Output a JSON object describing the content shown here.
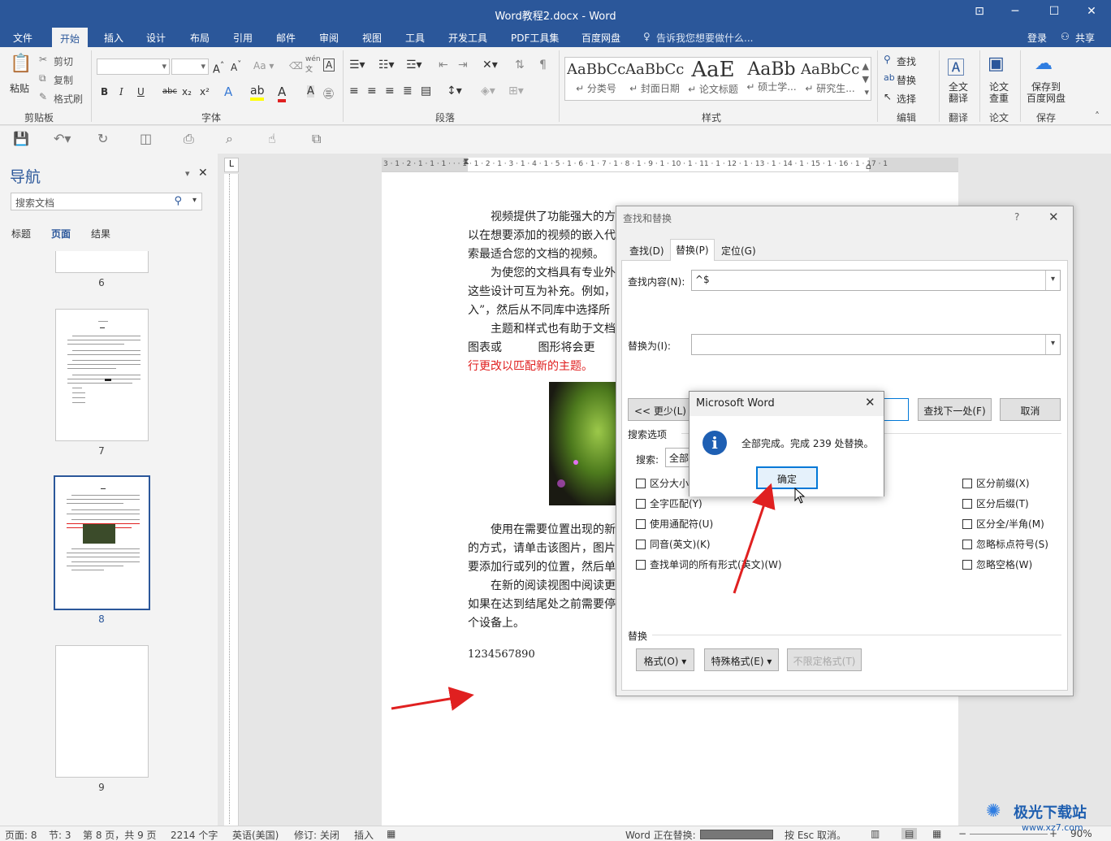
{
  "window": {
    "title": "Word教程2.docx - Word"
  },
  "menu": {
    "items": [
      "文件",
      "开始",
      "插入",
      "设计",
      "布局",
      "引用",
      "邮件",
      "审阅",
      "视图",
      "工具",
      "开发工具",
      "PDF工具集",
      "百度网盘"
    ],
    "tell_me": "告诉我您想要做什么...",
    "login": "登录",
    "share": "共享"
  },
  "ribbon": {
    "clipboard": {
      "paste": "粘贴",
      "cut": "剪切",
      "copy": "复制",
      "format_painter": "格式刷",
      "label": "剪贴板"
    },
    "font": {
      "label": "字体",
      "bold": "B",
      "italic": "I",
      "underline": "U",
      "strike": "abc"
    },
    "paragraph": {
      "label": "段落"
    },
    "styles": {
      "label": "样式",
      "items": [
        {
          "sample": "AaBbCc",
          "name": "↵ 分类号"
        },
        {
          "sample": "AaBbCc",
          "name": "↵ 封面日期"
        },
        {
          "sample": "AaE",
          "name": "↵ 论文标题"
        },
        {
          "sample": "AaBb",
          "name": "↵ 硕士学..."
        },
        {
          "sample": "AaBbCc",
          "name": "↵ 研究生..."
        }
      ]
    },
    "editing": {
      "find": "查找",
      "replace": "替换",
      "select": "选择",
      "label": "编辑"
    },
    "translate": {
      "btn": "全文\n翻译",
      "label": "翻译"
    },
    "paper": {
      "btn": "论文\n查重",
      "label": "论文"
    },
    "save": {
      "btn": "保存到\n百度网盘",
      "label": "保存"
    }
  },
  "nav": {
    "title": "导航",
    "search_placeholder": "搜索文档",
    "tabs": [
      "标题",
      "页面",
      "结果"
    ],
    "pages": [
      "6",
      "7",
      "8",
      "9"
    ]
  },
  "ruler": {
    "h": "3 · 1 · 2 · 1 · 1 · 1 · · · 1 · 1 · 2 · 1 · 3 · 1 · 4 · 1 · 5 · 1 · 6 · 1 · 7 · 1 · 8 · 1 · 9 · 1 · 10 · 1 · 11 · 1 · 12 · 1 · 13 · 1 · 14 · 1 · 15 · 1 · 16 · 1 · 17 · 1"
  },
  "document": {
    "lines": [
      "视频提供了功能强大的方",
      "以在想要添加的视频的嵌入代",
      "索最适合您的文档的视频。",
      "为使您的文档具有专业外",
      "这些设计可互为补充。例如，",
      "入”，然后从不同库中选择所",
      "主题和样式也有助于文档",
      "图表或          图形将会更",
      "行更改以匹配新的主题。",
      "使用在需要位置出现的新",
      "的方式，请单击该图片，图片",
      "要添加行或列的位置，然后单",
      "在新的阅读视图中阅读更",
      "如果在达到结尾处之前需要停",
      "个设备上。",
      "1234567890"
    ]
  },
  "find_replace": {
    "title": "查找和替换",
    "help": "?",
    "tabs": [
      "查找(D)",
      "替换(P)",
      "定位(G)"
    ],
    "find_label": "查找内容(N):",
    "find_value": "^$",
    "replace_label": "替换为(I):",
    "replace_value": "",
    "less_btn": "<< 更少(L)",
    "find_next_btn": "查找下一处(F)",
    "cancel_btn": "取消",
    "search_options": "搜索选项",
    "search_label": "搜索:",
    "search_value": "全部",
    "left_checks": [
      "区分大小写(H)",
      "全字匹配(Y)",
      "使用通配符(U)",
      "同音(英文)(K)",
      "查找单词的所有形式(英文)(W)"
    ],
    "right_checks": [
      "区分前缀(X)",
      "区分后缀(T)",
      "区分全/半角(M)",
      "忽略标点符号(S)",
      "忽略空格(W)"
    ],
    "replace_section": "替换",
    "format_btn": "格式(O) ▾",
    "special_btn": "特殊格式(E) ▾",
    "no_format_btn": "不限定格式(T)"
  },
  "message_box": {
    "title": "Microsoft Word",
    "icon": "info-icon",
    "text": "全部完成。完成 239 处替换。",
    "ok": "确定"
  },
  "status": {
    "page": "页面: 8",
    "section": "节: 3",
    "page_of": "第 8 页，共 9 页",
    "words": "2214 个字",
    "lang": "英语(美国)",
    "track": "修订: 关闭",
    "insert": "插入",
    "progress_text": "Word 正在替换:",
    "esc": "按 Esc 取消。",
    "zoom": "90%"
  },
  "watermark": {
    "text": "极光下载站",
    "url": "www.xz7.com"
  },
  "colors": {
    "brand": "#2b579a",
    "annotation_arrow": "#e02020",
    "highlight": "#0078d7"
  }
}
